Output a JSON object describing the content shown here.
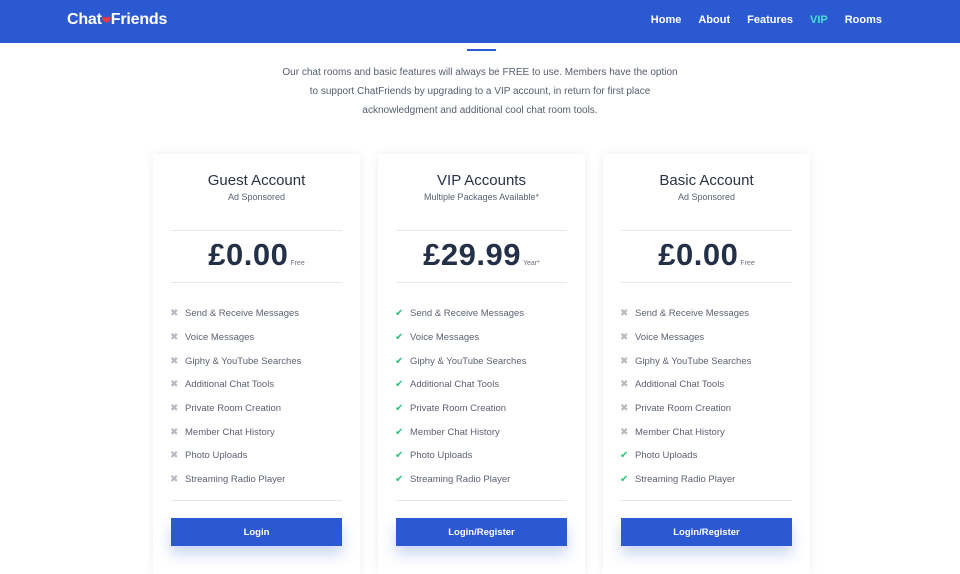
{
  "brand": {
    "before": "Chat",
    "after": "Friends"
  },
  "nav": [
    {
      "label": "Home"
    },
    {
      "label": "About"
    },
    {
      "label": "Features"
    },
    {
      "label": "VIP",
      "active": true
    },
    {
      "label": "Rooms"
    }
  ],
  "intro": {
    "line1": "Our chat rooms and basic features will always be FREE to use. Members have the option",
    "line2": "to support ChatFriends by upgrading to a VIP account, in return for first place",
    "line3": "acknowledgment and additional cool chat room tools."
  },
  "colors": {
    "accent": "#2b59d1",
    "active_nav": "#48e0d3",
    "check": "#2fc27a",
    "cross": "#b5b9c2"
  },
  "plans": [
    {
      "title": "Guest Account",
      "subtitle": "Ad Sponsored",
      "price": "£0.00",
      "period": "Free",
      "button": "Login",
      "features": [
        {
          "label": "Send & Receive Messages",
          "included": false
        },
        {
          "label": "Voice Messages",
          "included": false
        },
        {
          "label": "Giphy & YouTube Searches",
          "included": false
        },
        {
          "label": "Additional Chat Tools",
          "included": false
        },
        {
          "label": "Private Room Creation",
          "included": false
        },
        {
          "label": "Member Chat History",
          "included": false
        },
        {
          "label": "Photo Uploads",
          "included": false
        },
        {
          "label": "Streaming Radio Player",
          "included": false
        }
      ]
    },
    {
      "title": "VIP Accounts",
      "subtitle": "Multiple Packages Available*",
      "price": "£29.99",
      "period": "Year*",
      "button": "Login/Register",
      "features": [
        {
          "label": "Send & Receive Messages",
          "included": true
        },
        {
          "label": "Voice Messages",
          "included": true
        },
        {
          "label": "Giphy & YouTube Searches",
          "included": true
        },
        {
          "label": "Additional Chat Tools",
          "included": true
        },
        {
          "label": "Private Room Creation",
          "included": true
        },
        {
          "label": "Member Chat History",
          "included": true
        },
        {
          "label": "Photo Uploads",
          "included": true
        },
        {
          "label": "Streaming Radio Player",
          "included": true
        }
      ]
    },
    {
      "title": "Basic Account",
      "subtitle": "Ad Sponsored",
      "price": "£0.00",
      "period": "Free",
      "button": "Login/Register",
      "features": [
        {
          "label": "Send & Receive Messages",
          "included": false
        },
        {
          "label": "Voice Messages",
          "included": false
        },
        {
          "label": "Giphy & YouTube Searches",
          "included": false
        },
        {
          "label": "Additional Chat Tools",
          "included": false
        },
        {
          "label": "Private Room Creation",
          "included": false
        },
        {
          "label": "Member Chat History",
          "included": false
        },
        {
          "label": "Photo Uploads",
          "included": true
        },
        {
          "label": "Streaming Radio Player",
          "included": true
        }
      ]
    }
  ]
}
